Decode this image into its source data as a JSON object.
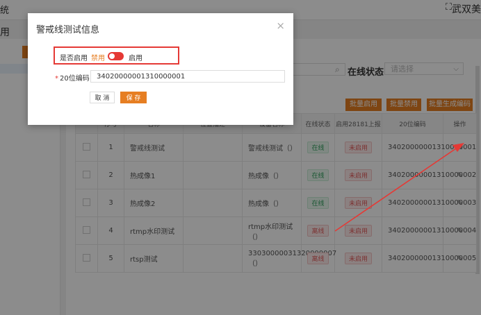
{
  "app": {
    "breadcrumb_fragment": "统",
    "user_name": "武双美",
    "expand_icon": "expand-icon",
    "left_title_fragment": "用"
  },
  "filters": {
    "status_label": "在线状态:",
    "status_placeholder": "请选择"
  },
  "batch_buttons": {
    "enable": "批量启用",
    "disable": "批量禁用",
    "generate": "批量生成编码"
  },
  "table": {
    "columns": [
      "",
      "序号",
      "名称",
      "位置描述",
      "设备名称",
      "在线状态",
      "启用28181上报",
      "20位编码",
      "操作"
    ],
    "rows": [
      {
        "index": "1",
        "name": "警戒线测试",
        "device": "警戒线测试（）",
        "online": "在线",
        "report": "未启用",
        "code": "34020000001310000001"
      },
      {
        "index": "2",
        "name": "热成像1",
        "device": "热成像（）",
        "online": "在线",
        "report": "未启用",
        "code": "34020000001310000002"
      },
      {
        "index": "3",
        "name": "热成像2",
        "device": "热成像（）",
        "online": "在线",
        "report": "未启用",
        "code": "34020000001310000003"
      },
      {
        "index": "4",
        "name": "rtmp水印测试",
        "device": "rtmp水印测试（）",
        "online": "离线",
        "report": "未启用",
        "code": "34020000001310000004"
      },
      {
        "index": "5",
        "name": "rtsp测试",
        "device": "33030000031320000007（）",
        "online": "离线",
        "report": "未启用",
        "code": "34020000001310000005"
      }
    ]
  },
  "modal": {
    "title": "警戒线测试信息",
    "enable_label": "是否启用",
    "disabled_text": "禁用",
    "enabled_text": "启用",
    "toggle_state": "off",
    "code_label": "20位编码",
    "code_value": "34020000001310000001",
    "cancel_label": "取 消",
    "save_label": "保 存"
  },
  "colors": {
    "accent": "#e67e22",
    "highlight": "#e53935",
    "online": "#2f9e5b",
    "offline": "#e25a5a"
  }
}
